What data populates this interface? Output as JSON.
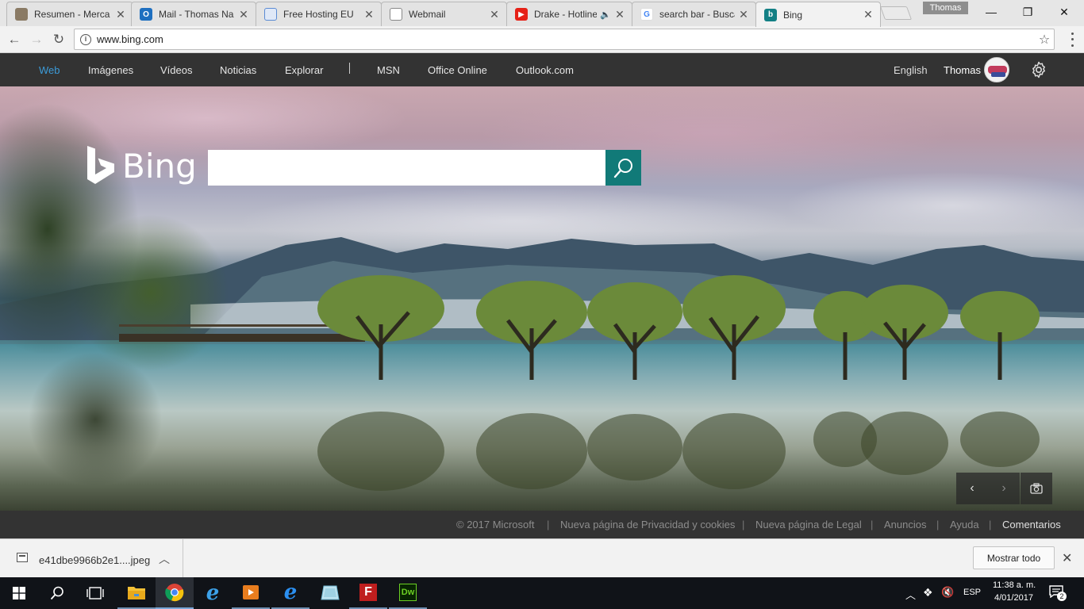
{
  "browser": {
    "tabs": [
      {
        "title": "Resumen - Merca",
        "favicon": "sombrero-icon",
        "color": "#7b6a55"
      },
      {
        "title": "Mail - Thomas Na",
        "favicon": "outlook-icon",
        "color": "#1e6fc0"
      },
      {
        "title": "Free Hosting EU",
        "favicon": "grid-icon",
        "color": "#5b8bd4"
      },
      {
        "title": "Webmail",
        "favicon": "page-icon",
        "color": "#ffffff"
      },
      {
        "title": "Drake - Hotline",
        "favicon": "youtube-icon",
        "color": "#e62117",
        "audio": "🔈"
      },
      {
        "title": "search bar - Busca",
        "favicon": "google-icon",
        "color": "#4285f4"
      },
      {
        "title": "Bing",
        "favicon": "bing-icon",
        "color": "#138085"
      }
    ],
    "profile_name": "Thomas",
    "url": "www.bing.com"
  },
  "bing": {
    "nav": [
      {
        "label": "Web",
        "active": true
      },
      {
        "label": "Imágenes"
      },
      {
        "label": "Vídeos"
      },
      {
        "label": "Noticias"
      },
      {
        "label": "Explorar"
      },
      {
        "label": "MSN"
      },
      {
        "label": "Office Online"
      },
      {
        "label": "Outlook.com"
      }
    ],
    "language": "English",
    "user": "Thomas",
    "logo_text": "Bing",
    "search_value": "",
    "accent": "#117a78",
    "footer": [
      "© 2017 Microsoft",
      "Nueva página de Privacidad y cookies",
      "Nueva página de Legal",
      "Anuncios",
      "Ayuda",
      "Comentarios"
    ]
  },
  "downloads": {
    "file": "e41dbe9966b2e1....jpeg",
    "show_all": "Mostrar todo"
  },
  "taskbar": {
    "apps": [
      "file-explorer-icon",
      "chrome-icon",
      "edge-icon",
      "media-player-icon",
      "internet-explorer-icon",
      "sketch-icon",
      "filezilla-icon",
      "dreamweaver-icon"
    ],
    "lang": "ESP",
    "time": "11:38 a. m.",
    "date": "4/01/2017",
    "notifications": "2",
    "filezilla_label": "F",
    "dreamweaver_label": "Dw"
  }
}
